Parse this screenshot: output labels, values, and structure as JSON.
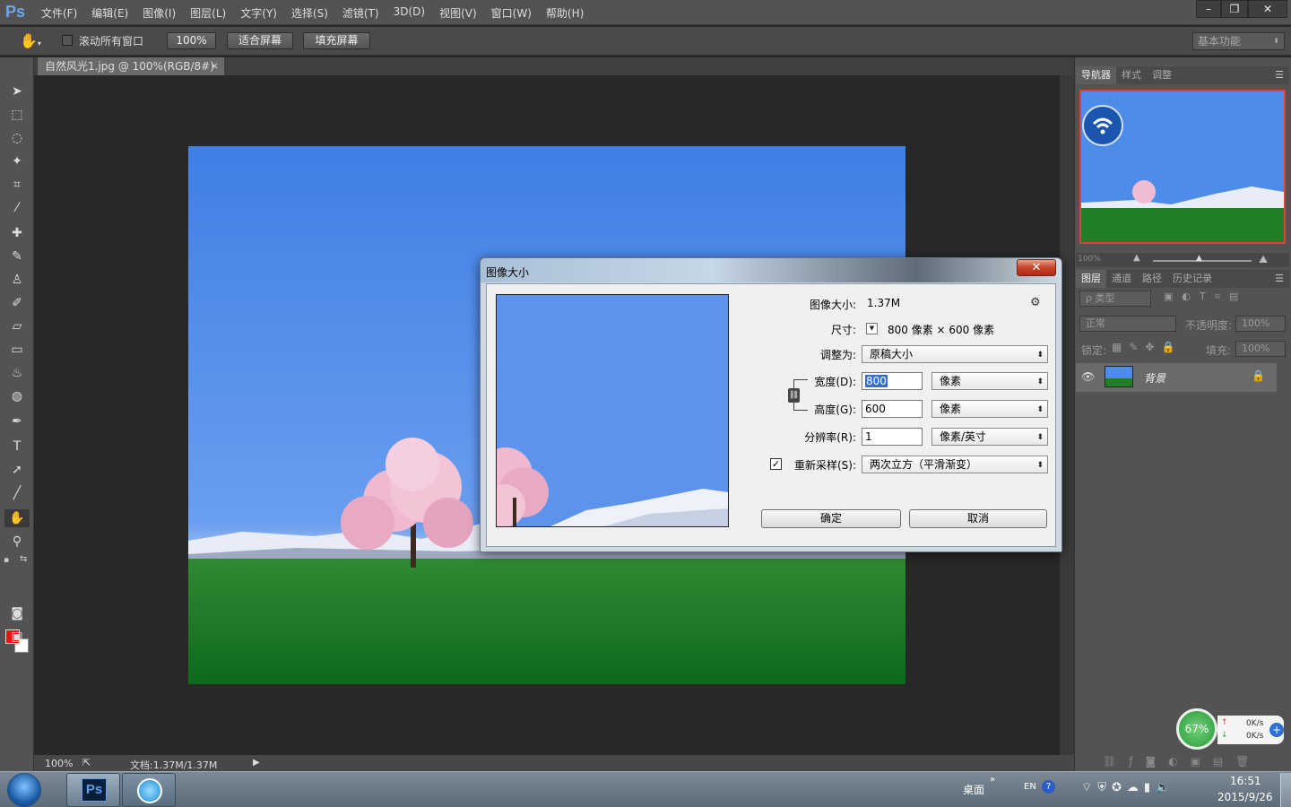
{
  "app": {
    "logo": "Ps"
  },
  "menubar": {
    "items": [
      "文件(F)",
      "编辑(E)",
      "图像(I)",
      "图层(L)",
      "文字(Y)",
      "选择(S)",
      "滤镜(T)",
      "3D(D)",
      "视图(V)",
      "窗口(W)",
      "帮助(H)"
    ],
    "min": "–",
    "restore": "❐",
    "close": "✕"
  },
  "options": {
    "scroll_all_label": "滚动所有窗口",
    "zoom_100": "100%",
    "fit_screen": "适合屏幕",
    "fill_screen": "填充屏幕",
    "workspace": "基本功能"
  },
  "document": {
    "tab_title": "自然风光1.jpg @ 100%(RGB/8#)",
    "tab_close": "×",
    "status_zoom": "100%",
    "status_doc": "文档:1.37M/1.37M"
  },
  "navigator": {
    "tabs": [
      "导航器",
      "样式",
      "调整"
    ],
    "zoom": "100%"
  },
  "layers": {
    "tabs": [
      "图层",
      "通道",
      "路径",
      "历史记录"
    ],
    "filter_kind": "ρ 类型",
    "blend_mode": "正常",
    "opacity_label": "不透明度:",
    "opacity_value": "100%",
    "lock_label": "锁定:",
    "fill_label": "填充:",
    "fill_value": "100%",
    "layer_name": "背景"
  },
  "dialog": {
    "title": "图像大小",
    "close": "✕",
    "image_size_label": "图像大小:",
    "image_size_value": "1.37M",
    "dimensions_label": "尺寸:",
    "dimensions_value": "800 像素 × 600 像素",
    "fit_to_label": "调整为:",
    "fit_to_value": "原稿大小",
    "width_label": "宽度(D):",
    "width_value": "800",
    "width_unit": "像素",
    "height_label": "高度(G):",
    "height_value": "600",
    "height_unit": "像素",
    "resolution_label": "分辨率(R):",
    "resolution_value": "1",
    "resolution_unit": "像素/英寸",
    "resample_label": "重新采样(S):",
    "resample_checked": true,
    "resample_value": "两次立方（平滑渐变）",
    "ok": "确定",
    "cancel": "取消"
  },
  "netmon": {
    "percent": "67%",
    "up": "0K/s",
    "down": "0K/s"
  },
  "taskbar": {
    "desktop": "桌面",
    "lang": "EN",
    "time": "16:51",
    "date": "2015/9/26"
  }
}
